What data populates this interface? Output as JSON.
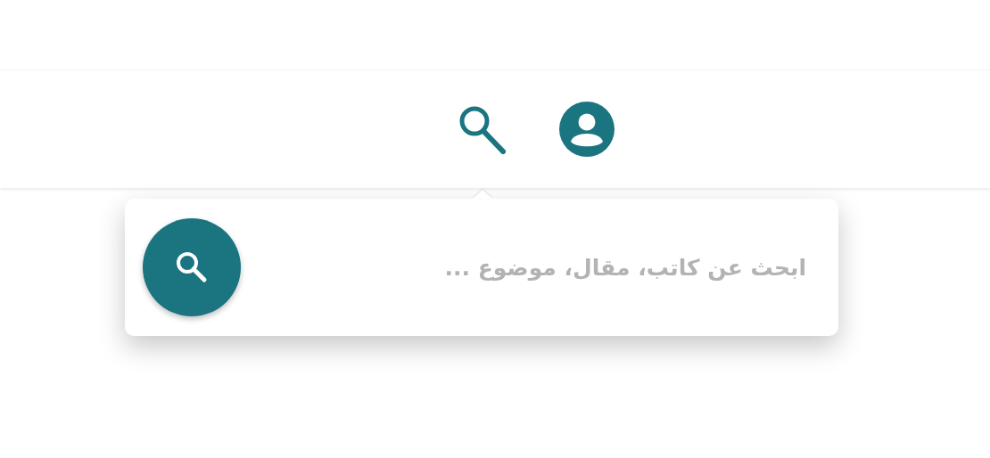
{
  "search": {
    "placeholder": "ابحث عن كاتب، مقال، موضوع ..."
  }
}
